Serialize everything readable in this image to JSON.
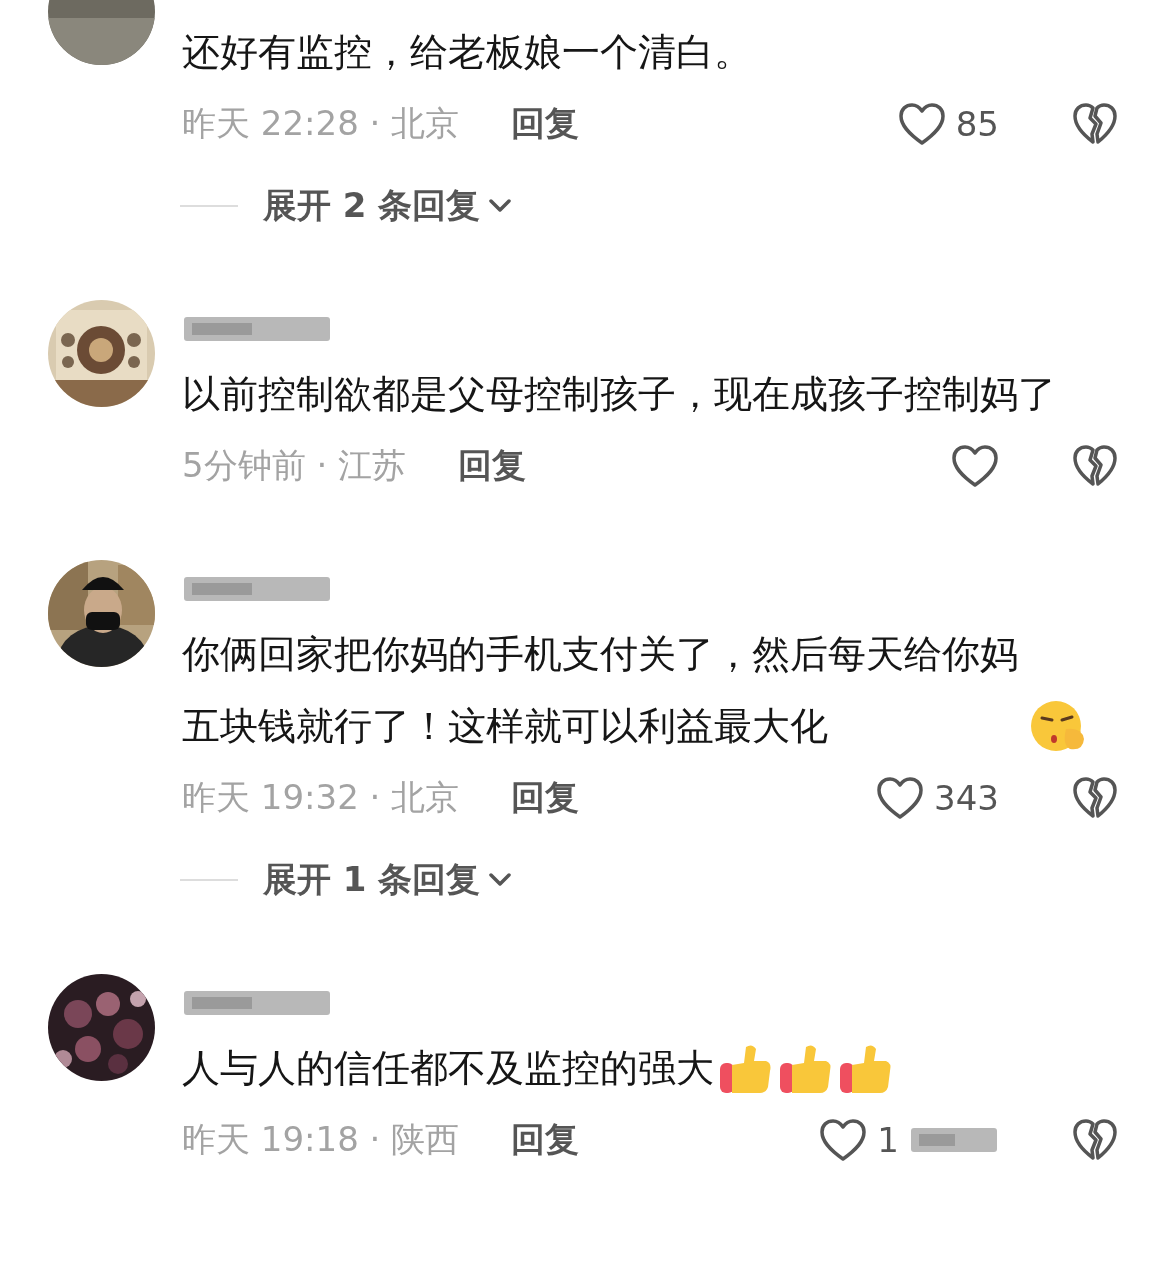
{
  "comments": [
    {
      "avatar": {
        "kind": "picture"
      },
      "text": "还好有监控，给老板娘一个清白。",
      "meta": "昨天 22:28 · 北京",
      "reply": "回复",
      "likes": "85",
      "expand": "展开 2 条回复"
    },
    {
      "avatar": {
        "kind": "picture"
      },
      "name_obscured": true,
      "text": "以前控制欲都是父母控制孩子，现在成孩子控制妈了",
      "meta": "5分钟前 · 江苏",
      "reply": "回复"
    },
    {
      "avatar": {
        "kind": "picture"
      },
      "name_obscured": true,
      "text": "你俩回家把你妈的手机支付关了，然后每天给你妈五块钱就行了！这样就可以利益最大化",
      "emojis": [
        {
          "kind": "smirk"
        }
      ],
      "meta": "昨天 19:32 · 北京",
      "reply": "回复",
      "likes": "343",
      "expand": "展开 1 条回复"
    },
    {
      "avatar": {
        "kind": "picture"
      },
      "name_obscured": true,
      "text": "人与人的信任都不及监控的强大",
      "emojis": [
        {
          "kind": "thumbs_up"
        },
        {
          "kind": "thumbs_up"
        },
        {
          "kind": "thumbs_up"
        }
      ],
      "meta": "昨天 19:18 · 陕西",
      "reply": "回复",
      "likes": "1",
      "likes_obscured": true
    }
  ]
}
